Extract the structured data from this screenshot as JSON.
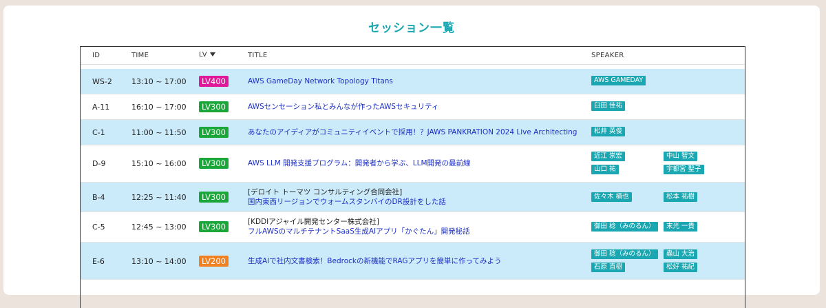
{
  "page": {
    "title": "セッション一覧"
  },
  "colors": {
    "accent": "#1ba7b1",
    "row_alt": "#cbeafa",
    "link": "#1b2fc4",
    "LV400": "#e0189a",
    "LV300": "#1aa639",
    "LV200": "#f08122"
  },
  "table": {
    "headers": {
      "id": "ID",
      "time": "TIME",
      "lv": "LV",
      "title": "TITLE",
      "speaker": "SPEAKER"
    },
    "sort_icon": "sort-desc-icon",
    "rows": [
      {
        "id": "WS-2",
        "time": "13:10 ~ 17:00",
        "lv": "LV400",
        "org": "",
        "title": "AWS GameDay Network Topology Titans",
        "speakers": [
          "AWS GAMEDAY"
        ]
      },
      {
        "id": "A-11",
        "time": "16:10 ~ 17:00",
        "lv": "LV300",
        "org": "",
        "title": "AWSセンセーション私とみんなが作ったAWSセキュリティ",
        "speakers": [
          "臼田 佳祐"
        ]
      },
      {
        "id": "C-1",
        "time": "11:00 ~ 11:50",
        "lv": "LV300",
        "org": "",
        "title": "あなたのアイディアがコミュニティイベントで採用！？JAWS PANKRATION 2024 Live Architecting",
        "speakers": [
          "松井 英俊"
        ]
      },
      {
        "id": "D-9",
        "time": "15:10 ~ 16:00",
        "lv": "LV300",
        "org": "",
        "title": "AWS LLM 開発支援プログラム：開発者から学ぶ、LLM開発の最前線",
        "speakers": [
          "近江 崇宏",
          "中山 智文",
          "山口 祐",
          "宇都宮 聖子"
        ]
      },
      {
        "id": "B-4",
        "time": "12:25 ~ 11:40",
        "lv": "LV300",
        "org": "[デロイト トーマツ コンサルティング合同会社]",
        "title": "国内東西リージョンでウォームスタンバイのDR設計をした話",
        "speakers": [
          "佐々木 槇也",
          "松本 祐樹"
        ]
      },
      {
        "id": "C-5",
        "time": "12:45 ~ 13:00",
        "lv": "LV300",
        "org": "[KDDIアジャイル開発センター株式会社]",
        "title": "フルAWSのマルチテナントSaaS生成AIアプリ「かぐたん」開発秘話",
        "speakers": [
          "御田 稔（みのるん）",
          "末光 一貴"
        ]
      },
      {
        "id": "E-6",
        "time": "13:10 ~ 14:00",
        "lv": "LV200",
        "org": "",
        "title": "生成AIで社内文書検索！Bedrockの新機能でRAGアプリを簡単に作ってみよう",
        "speakers": [
          "御田 稔（みのるん）",
          "蟲山 大治",
          "石原 直樹",
          "松好 祐紀"
        ]
      }
    ]
  }
}
